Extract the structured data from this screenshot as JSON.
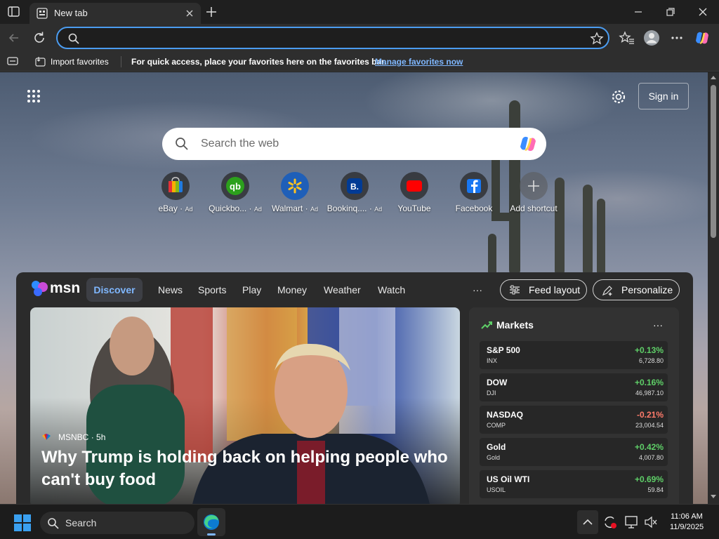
{
  "tab": {
    "title": "New tab"
  },
  "favorites_bar": {
    "import_label": "Import favorites",
    "message": "For quick access, place your favorites here on the favorites bar.",
    "manage_link": "Manage favorites now"
  },
  "newtab": {
    "search_placeholder": "Search the web",
    "signin_label": "Sign in",
    "tiles": [
      {
        "label": "eBay",
        "ad": "Ad",
        "icon": "ebay-icon"
      },
      {
        "label": "Quickbo...",
        "ad": "Ad",
        "icon": "quickbooks-icon"
      },
      {
        "label": "Walmart",
        "ad": "Ad",
        "icon": "walmart-icon"
      },
      {
        "label": "Bookinq....",
        "ad": "Ad",
        "icon": "booking-icon"
      },
      {
        "label": "YouTube",
        "ad": "",
        "icon": "youtube-icon"
      },
      {
        "label": "Facebook",
        "ad": "",
        "icon": "facebook-icon"
      },
      {
        "label": "Add shortcut",
        "ad": "",
        "icon": "plus-icon"
      }
    ]
  },
  "feed": {
    "brand": "msn",
    "nav": [
      "Discover",
      "News",
      "Sports",
      "Play",
      "Money",
      "Weather",
      "Watch"
    ],
    "more": "···",
    "feed_layout_label": "Feed layout",
    "personalize_label": "Personalize",
    "hero": {
      "source": "MSNBC",
      "age": "· 5h",
      "headline": "Why Trump is holding back on helping people who can't buy food"
    },
    "markets": {
      "title": "Markets",
      "rows": [
        {
          "name": "S&P 500",
          "code": "INX",
          "change": "+0.13%",
          "value": "6,728.80",
          "up": true
        },
        {
          "name": "DOW",
          "code": "DJI",
          "change": "+0.16%",
          "value": "46,987.10",
          "up": true
        },
        {
          "name": "NASDAQ",
          "code": "COMP",
          "change": "-0.21%",
          "value": "23,004.54",
          "up": false
        },
        {
          "name": "Gold",
          "code": "Gold",
          "change": "+0.42%",
          "value": "4,007.80",
          "up": true
        },
        {
          "name": "US Oil WTI",
          "code": "USOIL",
          "change": "+0.69%",
          "value": "59.84",
          "up": true
        }
      ]
    }
  },
  "taskbar": {
    "search_placeholder": "Search",
    "time": "11:06 AM",
    "date": "11/9/2025"
  },
  "colors": {
    "accent": "#4b9cf0",
    "positive": "#5fd068",
    "negative": "#ff7b6b",
    "link": "#7fb7ff"
  }
}
